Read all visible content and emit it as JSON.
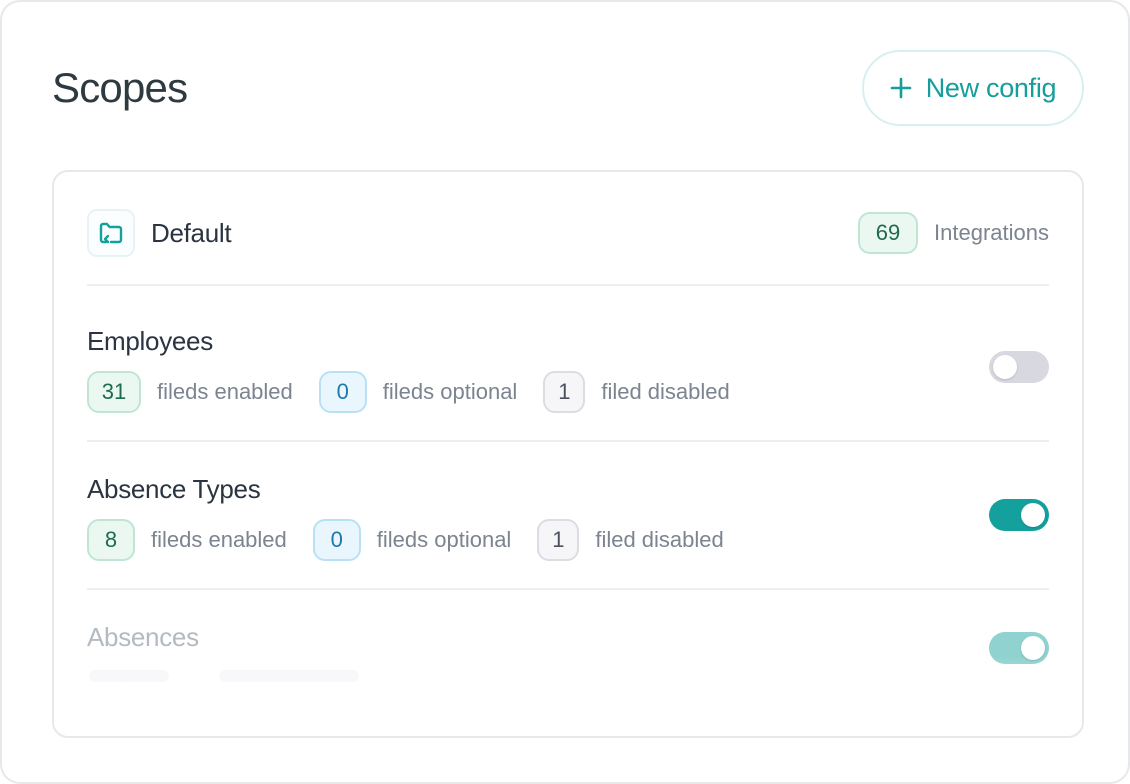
{
  "header": {
    "title": "Scopes",
    "new_config_label": "New config"
  },
  "default_scope": {
    "name": "Default",
    "integrations_count": "69",
    "integrations_label": "Integrations"
  },
  "scopes": [
    {
      "name": "Employees",
      "enabled_count": "31",
      "enabled_label": "fileds enabled",
      "optional_count": "0",
      "optional_label": "fileds optional",
      "disabled_count": "1",
      "disabled_label": "filed disabled",
      "toggle_on": false
    },
    {
      "name": "Absence Types",
      "enabled_count": "8",
      "enabled_label": "fileds enabled",
      "optional_count": "0",
      "optional_label": "fileds optional",
      "disabled_count": "1",
      "disabled_label": "filed disabled",
      "toggle_on": true
    },
    {
      "name": "Absences",
      "toggle_on": true
    }
  ],
  "colors": {
    "accent": "#14a19d",
    "toggle_off": "#d8d8e0"
  }
}
